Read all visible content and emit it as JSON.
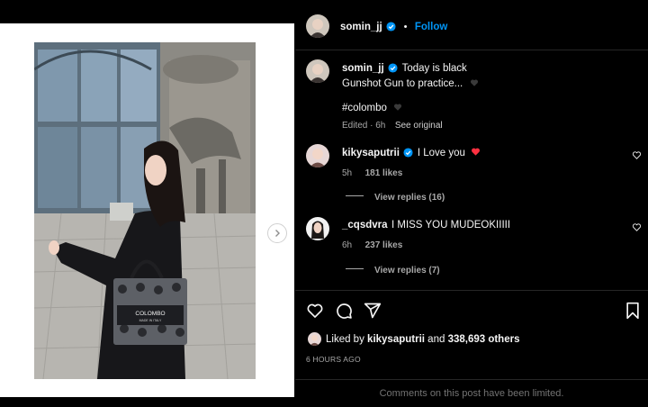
{
  "post": {
    "author": "somin_jj",
    "separator": "•",
    "follow_label": "Follow",
    "caption_line1": "Today is black",
    "caption_line2": "Gunshot Gun to practice...",
    "hashtag": "#colombo",
    "edited": "Edited · 6h",
    "see_original": "See original",
    "bag_brand": "COLOMBO",
    "bag_sub": "MADE IN ITALY"
  },
  "comments": [
    {
      "user": "kikysaputrii",
      "text": "I Love you",
      "time": "5h",
      "likes": "181 likes",
      "view_replies": "View replies (16)"
    },
    {
      "user": "_cqsdvra",
      "text": "I MISS YOU MUDEOKIIIII",
      "time": "6h",
      "likes": "237 likes",
      "view_replies": "View replies (7)"
    }
  ],
  "likes_summary": {
    "prefix": "Liked by",
    "user": "kikysaputrii",
    "and": "and",
    "others": "338,693 others"
  },
  "timestamp": "6 HOURS AGO",
  "comments_limited": "Comments on this post have been limited.",
  "colors": {
    "background": "#000000",
    "link_blue": "#0095f6",
    "heart_red": "#ff3040",
    "muted": "#a8a8a8"
  },
  "icons": [
    "verified-icon",
    "heart-icon",
    "comment-icon",
    "share-icon",
    "save-icon",
    "chevron-right-icon",
    "black-heart-emoji",
    "red-heart-emoji"
  ]
}
